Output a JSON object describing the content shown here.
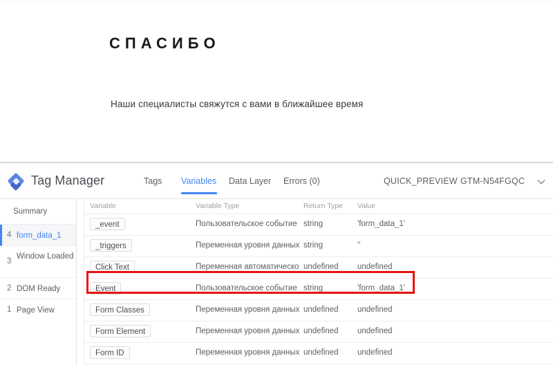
{
  "thankyou": {
    "title": "СПАСИБО",
    "subtitle": "Наши специалисты свяжутся с вами в ближайшее время"
  },
  "gtm": {
    "brand": "Tag Manager",
    "logo_icon": "tag-manager-diamond-icon",
    "colors": {
      "accent": "#4285f4",
      "logo_dark": "#4169c9",
      "logo_light": "#8ab4f8",
      "highlight": "#e8120e",
      "text": "#5b5e63",
      "muted": "#9aa0a6"
    },
    "tabs": [
      {
        "id": "tags",
        "label": "Tags",
        "active": false
      },
      {
        "id": "variables",
        "label": "Variables",
        "active": true
      },
      {
        "id": "datalayer",
        "label": "Data Layer",
        "active": false
      },
      {
        "id": "errors",
        "label": "Errors (0)",
        "active": false
      }
    ],
    "quick_preview_label": "QUICK_PREVIEW",
    "container_id": "GTM-N54FGQC",
    "chevron_icon": "chevron-down-icon",
    "sidebar": {
      "summary_label": "Summary",
      "items": [
        {
          "num": "4",
          "label": "form_data_1",
          "active": true
        },
        {
          "num": "3",
          "label": "Window Loaded",
          "active": false
        },
        {
          "num": "2",
          "label": "DOM Ready",
          "active": false
        },
        {
          "num": "1",
          "label": "Page View",
          "active": false
        }
      ]
    },
    "table": {
      "columns": {
        "variable": "Variable",
        "variable_type": "Variable Type",
        "return_type": "Return Type",
        "value": "Value"
      },
      "rows": [
        {
          "variable": "_event",
          "variable_type": "Пользовательское событие",
          "return_type": "string",
          "value": "'form_data_1'",
          "highlighted": false
        },
        {
          "variable": "_triggers",
          "variable_type": "Переменная уровня данных",
          "return_type": "string",
          "value": "''",
          "highlighted": false
        },
        {
          "variable": "Click Text",
          "variable_type": "Переменная автоматического",
          "return_type": "undefined",
          "value": "undefined",
          "highlighted": false
        },
        {
          "variable": "Event",
          "variable_type": "Пользовательское событие",
          "return_type": "string",
          "value": "'form_data_1'",
          "highlighted": true
        },
        {
          "variable": "Form Classes",
          "variable_type": "Переменная уровня данных",
          "return_type": "undefined",
          "value": "undefined",
          "highlighted": false
        },
        {
          "variable": "Form Element",
          "variable_type": "Переменная уровня данных",
          "return_type": "undefined",
          "value": "undefined",
          "highlighted": false
        },
        {
          "variable": "Form ID",
          "variable_type": "Переменная уровня данных",
          "return_type": "undefined",
          "value": "undefined",
          "highlighted": false
        }
      ]
    }
  }
}
